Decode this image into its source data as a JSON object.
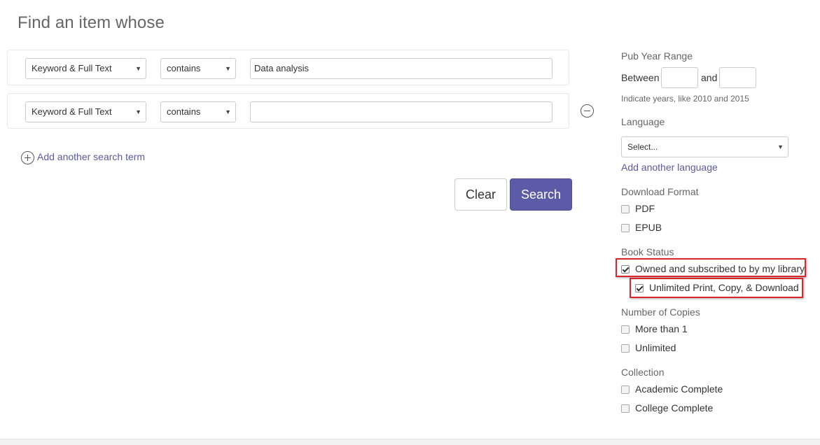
{
  "page_title": "Find an item whose",
  "search_rows": [
    {
      "field": "Keyword & Full Text",
      "operator": "contains",
      "value": "Data analysis"
    },
    {
      "field": "Keyword & Full Text",
      "operator": "contains",
      "value": ""
    }
  ],
  "add_term_label": "Add another search term",
  "buttons": {
    "clear": "Clear",
    "search": "Search"
  },
  "icons": {
    "dropdown": "▼",
    "remove": "minus-circle-icon",
    "add": "plus-circle-icon"
  },
  "pub_year": {
    "label": "Pub Year Range",
    "between": "Between",
    "and": "and",
    "hint": "Indicate years, like 2010 and 2015"
  },
  "language": {
    "label": "Language",
    "placeholder": "Select...",
    "add_link": "Add another language"
  },
  "download_format": {
    "label": "Download Format",
    "options": [
      {
        "label": "PDF",
        "checked": false
      },
      {
        "label": "EPUB",
        "checked": false
      }
    ]
  },
  "book_status": {
    "label": "Book Status",
    "options": [
      {
        "label": "Owned and subscribed to by my library",
        "checked": true
      },
      {
        "label": "Unlimited Print, Copy, & Download",
        "checked": true
      }
    ]
  },
  "copies": {
    "label": "Number of Copies",
    "options": [
      {
        "label": "More than 1",
        "checked": false
      },
      {
        "label": "Unlimited",
        "checked": false
      }
    ]
  },
  "collection": {
    "label": "Collection",
    "options": [
      {
        "label": "Academic Complete",
        "checked": false
      },
      {
        "label": "College Complete",
        "checked": false
      }
    ]
  },
  "colors": {
    "accent": "#5b5ba8",
    "link": "#5a5a9e",
    "highlight": "#d9262b"
  }
}
